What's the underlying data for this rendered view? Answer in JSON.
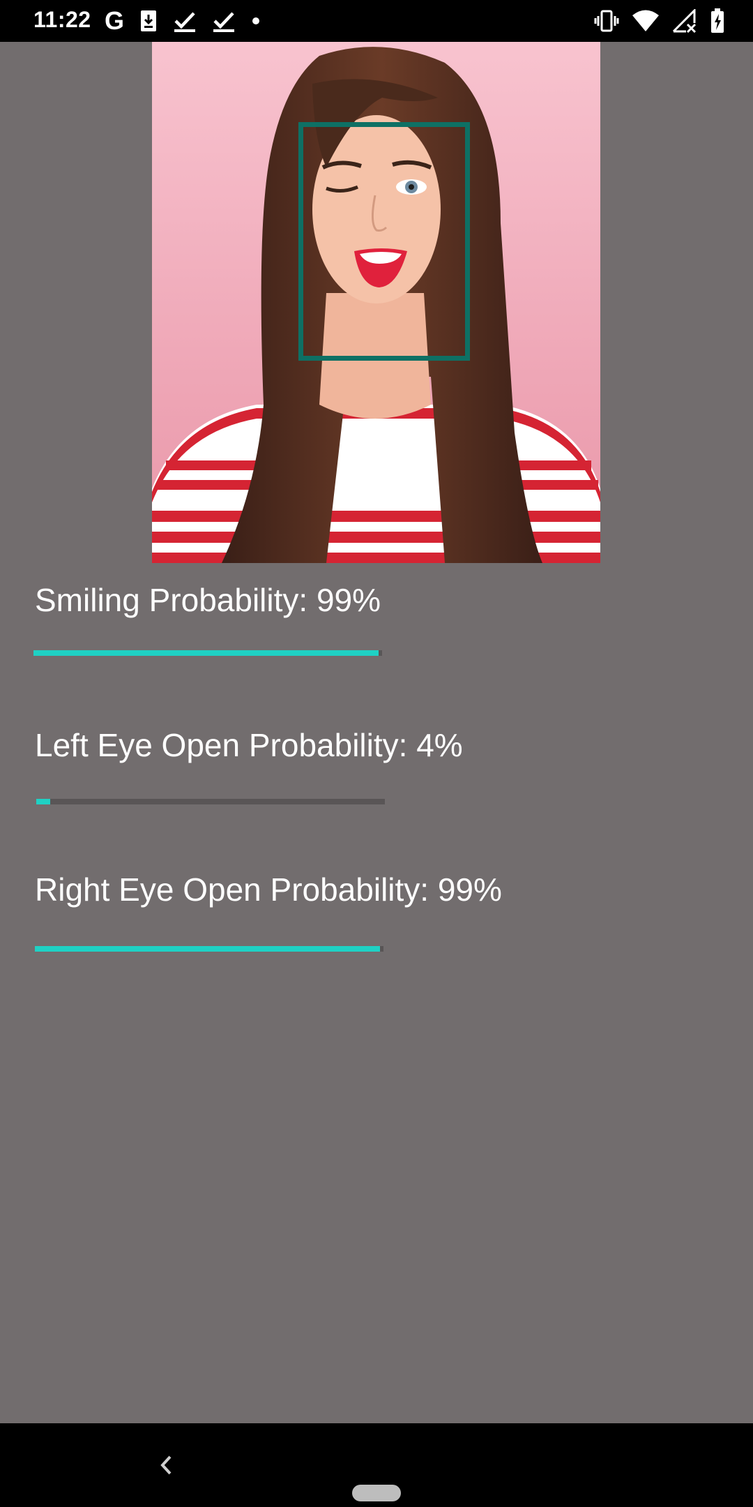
{
  "status_bar": {
    "time": "11:22",
    "left_icons": [
      "google-g-icon",
      "download-icon",
      "check-icon",
      "check-icon",
      "dot-icon"
    ],
    "right_icons": [
      "vibrate-icon",
      "wifi-icon",
      "signal-no-service-icon",
      "battery-charging-icon"
    ],
    "g_glyph": "G"
  },
  "photo": {
    "face_box_color": "#0e7064"
  },
  "metrics": [
    {
      "label": "Smiling Probability: 99%",
      "value": 0.99
    },
    {
      "label": "Left Eye Open Probability: 4%",
      "value": 0.04
    },
    {
      "label": "Right Eye Open Probability: 99%",
      "value": 0.99
    }
  ],
  "colors": {
    "background": "#726d6e",
    "accent": "#1fd1c4",
    "track": "#595556"
  },
  "nav_bar": {
    "back_icon": "back-chevron-icon",
    "home_icon": "home-pill-icon"
  }
}
